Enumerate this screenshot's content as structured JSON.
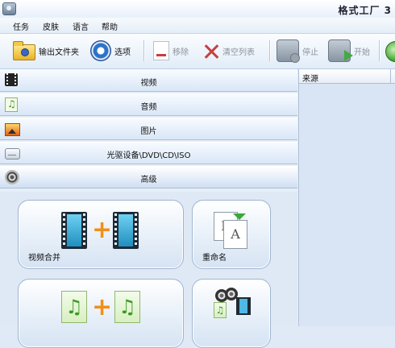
{
  "window": {
    "title": "格式工厂 3"
  },
  "menu": {
    "items": [
      "任务",
      "皮肤",
      "语言",
      "帮助"
    ]
  },
  "toolbar": {
    "output_folder": "输出文件夹",
    "options": "选项",
    "remove": "移除",
    "clear_list": "清空列表",
    "stop": "停止",
    "start": "开始"
  },
  "categories": [
    {
      "label": "视频",
      "icon": "film-icon"
    },
    {
      "label": "音频",
      "icon": "music-note-icon"
    },
    {
      "label": "图片",
      "icon": "picture-icon"
    },
    {
      "label": "光驱设备\\DVD\\CD\\ISO",
      "icon": "optical-drive-icon"
    },
    {
      "label": "高级",
      "icon": "reel-icon"
    }
  ],
  "advanced_tools": [
    {
      "label": "视频合并",
      "icon": "video-merge-icon"
    },
    {
      "label": "重命名",
      "icon": "rename-icon"
    },
    {
      "label": "",
      "icon": "audio-merge-icon"
    },
    {
      "label": "",
      "icon": "audio-video-mix-icon"
    }
  ],
  "task_list": {
    "column_source": "来源"
  },
  "colors": {
    "accent_orange": "#f28f18",
    "accent_green": "#3aa83a",
    "panel_blue": "#dfe9f6"
  }
}
